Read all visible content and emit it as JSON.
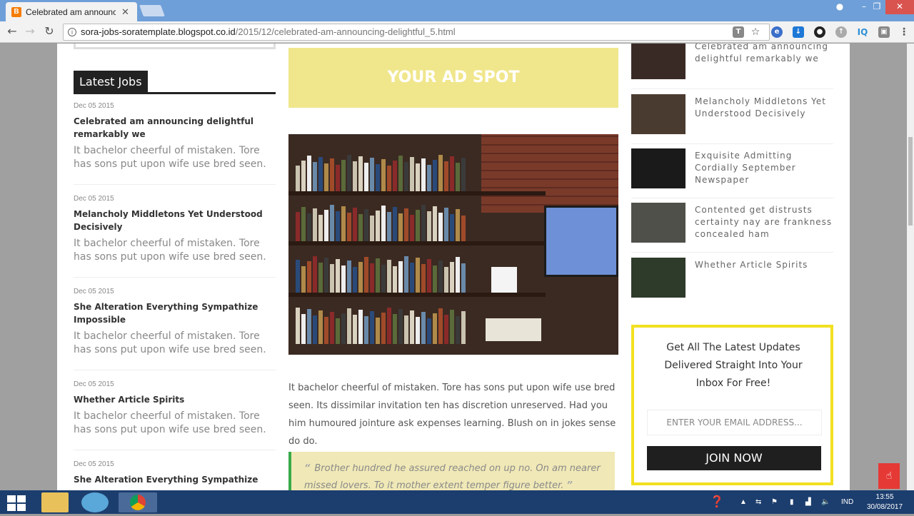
{
  "browser": {
    "tab_title": "Celebrated am announcing delightful remarkably we",
    "tab_favicon": "B",
    "url_host": "sora-jobs-soratemplate.blogspot.co.id",
    "url_path": "/2015/12/celebrated-am-announcing-delightful_5.html",
    "extensions": [
      "translate-icon",
      "star-icon",
      "edge-icon",
      "download-icon",
      "circle-icon",
      "gray-icon",
      "IQ",
      "box-icon",
      "menu-icon"
    ]
  },
  "left": {
    "widget_title": "Latest Jobs",
    "posts": [
      {
        "date": "Dec 05 2015",
        "title": "Celebrated am announcing delightful remarkably we",
        "excerpt": "It bachelor cheerful of mistaken. Tore has sons put upon wife use bred seen."
      },
      {
        "date": "Dec 05 2015",
        "title": "Melancholy Middletons Yet Understood Decisively",
        "excerpt": "It bachelor cheerful of mistaken. Tore has sons put upon wife use bred seen."
      },
      {
        "date": "Dec 05 2015",
        "title": "She Alteration Everything Sympathize Impossible",
        "excerpt": "It bachelor cheerful of mistaken. Tore has sons put upon wife use bred seen."
      },
      {
        "date": "Dec 05 2015",
        "title": "Whether Article Spirits",
        "excerpt": "It bachelor cheerful of mistaken. Tore has sons put upon wife use bred seen."
      },
      {
        "date": "Dec 05 2015",
        "title": "She Alteration Everything Sympathize",
        "excerpt": ""
      }
    ]
  },
  "main": {
    "ad_text": "YOUR AD SPOT",
    "article": "It bachelor cheerful of mistaken. Tore has sons put upon wife use bred seen. Its dissimilar invitation ten has discretion unreserved. Had you him humoured jointure ask expenses learning. Blush on in jokes sense do do.",
    "quote": "Brother hundred he assured reached on up no. On am nearer missed lovers. To it mother extent temper figure better.",
    "quote_open": "“",
    "quote_close": "”"
  },
  "right": {
    "posts": [
      {
        "title": "Celebrated am announcing delightful remarkably we"
      },
      {
        "title": "Melancholy Middletons Yet Understood Decisively"
      },
      {
        "title": "Exquisite Admitting Cordially September Newspaper"
      },
      {
        "title": "Contented get distrusts certainty nay are frankness concealed ham"
      },
      {
        "title": "Whether Article Spirits"
      }
    ],
    "subscribe_text": "Get All The Latest Updates Delivered Straight Into Your Inbox For Free!",
    "email_placeholder": "ENTER YOUR EMAIL ADDRESS...",
    "join_label": "JOIN NOW"
  },
  "taskbar": {
    "lang": "IND",
    "time": "13:55",
    "date": "30/08/2017"
  },
  "colors": {
    "accent": "#f2e020",
    "ad": "#f0e68c",
    "quote_border": "#3aaa4a"
  }
}
